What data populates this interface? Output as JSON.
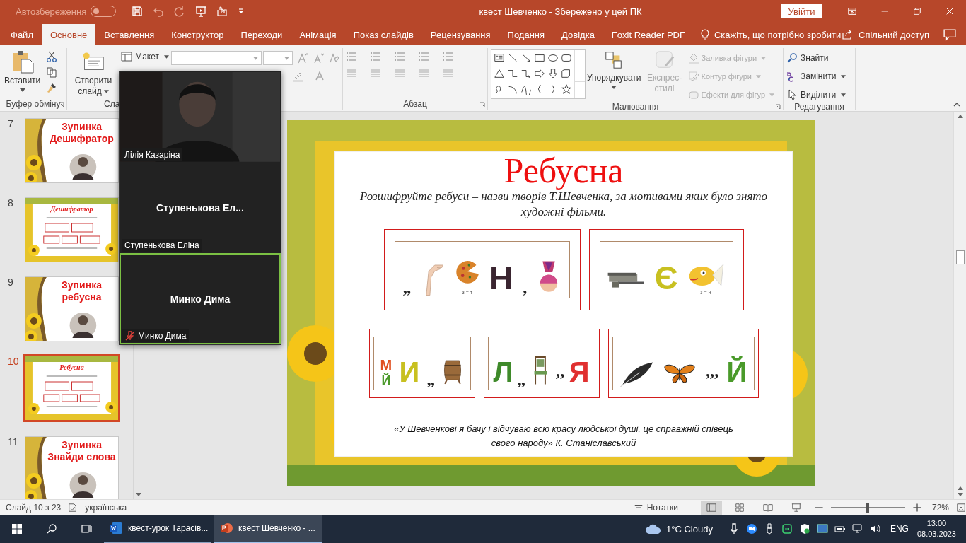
{
  "title_bar": {
    "autosave_label": "Автозбереження",
    "autosave_on": false,
    "title": "квест Шевченко -  Збережено у цей ПК",
    "sign_in": "Увійти"
  },
  "tabs": [
    {
      "label": "Файл",
      "selected": false
    },
    {
      "label": "Основне",
      "selected": true
    },
    {
      "label": "Вставлення",
      "selected": false
    },
    {
      "label": "Конструктор",
      "selected": false
    },
    {
      "label": "Переходи",
      "selected": false
    },
    {
      "label": "Анімація",
      "selected": false
    },
    {
      "label": "Показ слайдів",
      "selected": false
    },
    {
      "label": "Рецензування",
      "selected": false
    },
    {
      "label": "Подання",
      "selected": false
    },
    {
      "label": "Довідка",
      "selected": false
    },
    {
      "label": "Foxit Reader PDF",
      "selected": false
    }
  ],
  "tell_me": "Скажіть, що потрібно зробити",
  "share": "Спільний доступ",
  "ribbon": {
    "clipboard": {
      "paste": "Вставити",
      "label": "Буфер обміну"
    },
    "slides": {
      "new_slide": "Створити слайд",
      "layout": "Макет",
      "label": "Сла"
    },
    "paragraph": {
      "label": "Абзац"
    },
    "drawing": {
      "arrange": "Упорядкувати",
      "quick_styles": "Експрес-стилі",
      "fill": "Заливка фігури",
      "outline": "Контур фігури",
      "effects": "Ефекти для фігур",
      "label": "Малювання"
    },
    "editing": {
      "find": "Знайти",
      "replace": "Замінити",
      "select": "Виділити",
      "label": "Редагування"
    }
  },
  "thumbnails": [
    {
      "number": "7",
      "selected": false,
      "kind": "stop",
      "lines": [
        "Зупинка",
        "Дешифратор"
      ]
    },
    {
      "number": "8",
      "selected": false,
      "kind": "frame",
      "title": "Дешифратор"
    },
    {
      "number": "9",
      "selected": false,
      "kind": "stop",
      "lines": [
        "Зупинка",
        "ребусна"
      ]
    },
    {
      "number": "10",
      "selected": true,
      "kind": "frame",
      "title": "Ребусна"
    },
    {
      "number": "11",
      "selected": false,
      "kind": "stop",
      "lines": [
        "Зупинка",
        "Знайди слова"
      ]
    }
  ],
  "meeting": {
    "participants": [
      {
        "kind": "video",
        "name": "Лілія Казаріна",
        "muted": false,
        "speaking": false
      },
      {
        "kind": "name",
        "display": "Ступенькова  Ел...",
        "name": "Ступенькова Еліна",
        "muted": false,
        "speaking": false
      },
      {
        "kind": "name",
        "display": "Минко Дима",
        "name": "Минко Дима",
        "muted": true,
        "speaking": true
      }
    ]
  },
  "slide": {
    "title": "Ребусна",
    "subtitle": "Розшифруйте ребуси – назви творів Т.Шевченка, за мотивами яких було знято художні фільми.",
    "rebus_rows": [
      [
        {
          "items": [
            {
              "kind": "mark",
              "text": "„"
            },
            {
              "kind": "hand"
            },
            {
              "kind": "pizza",
              "hint": "з = т"
            },
            {
              "kind": "letter",
              "text": "Н",
              "color": "#3a2530"
            },
            {
              "kind": "mark",
              "text": ","
            },
            {
              "kind": "doll"
            }
          ]
        },
        {
          "items": [
            {
              "kind": "machine"
            },
            {
              "kind": "letter",
              "text": "Є",
              "color": "#c8c020"
            },
            {
              "kind": "fish",
              "hint": "з = н"
            }
          ]
        }
      ],
      [
        {
          "items": [
            {
              "kind": "fraction",
              "top": "М",
              "bottom": "Й"
            },
            {
              "kind": "letter",
              "text": "И",
              "color": "#c8c020"
            },
            {
              "kind": "mark",
              "text": "„"
            },
            {
              "kind": "barrel"
            }
          ]
        },
        {
          "items": [
            {
              "kind": "letter",
              "text": "Л",
              "color": "#3f8a2a"
            },
            {
              "kind": "mark",
              "text": "„"
            },
            {
              "kind": "chair"
            },
            {
              "kind": "mark",
              "text": "’’"
            },
            {
              "kind": "letter",
              "text": "Я",
              "color": "#e03030"
            }
          ]
        },
        {
          "items": [
            {
              "kind": "feather"
            },
            {
              "kind": "butterfly"
            },
            {
              "kind": "mark",
              "text": "’’’"
            },
            {
              "kind": "letter",
              "text": "Й",
              "color": "#4a9a2a"
            }
          ]
        }
      ]
    ],
    "quote": "«У Шевченкові я бачу і відчуваю всю красу людської душі, це справжній співець свого народу» К. Станіславський"
  },
  "status_bar": {
    "slide": "Слайд 10 з 23",
    "language": "українська",
    "notes": "Нотатки",
    "zoom": {
      "level": 0.5
    },
    "zoom_label": "72%"
  },
  "taskbar": {
    "apps": [
      {
        "kind": "word",
        "label": "квест-урок Тарасів...",
        "selected": false
      },
      {
        "kind": "powerpoint",
        "label": "квест Шевченко - ...",
        "selected": true
      }
    ],
    "weather": "1°C  Cloudy",
    "language": "ENG",
    "time": "13:00",
    "date": "08.03.2023"
  }
}
